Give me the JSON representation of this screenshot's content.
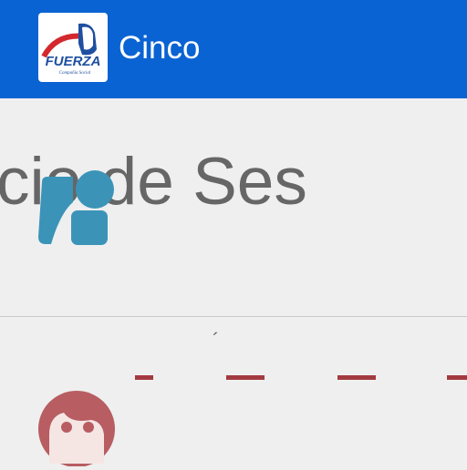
{
  "app": {
    "title": "Cinco",
    "logo_text": "FUERZA",
    "logo_tagline": "Compañía Social"
  },
  "login": {
    "heading_fragment": "cio de Ses",
    "accent_fragment": "´"
  },
  "icons": {
    "user": "user-id-icon",
    "face": "face-icon"
  },
  "colors": {
    "appbar": "#0a63d3",
    "user_icon": "#3b94b8",
    "dashes": "#a33a3f",
    "face_icon": "#b85d62"
  }
}
